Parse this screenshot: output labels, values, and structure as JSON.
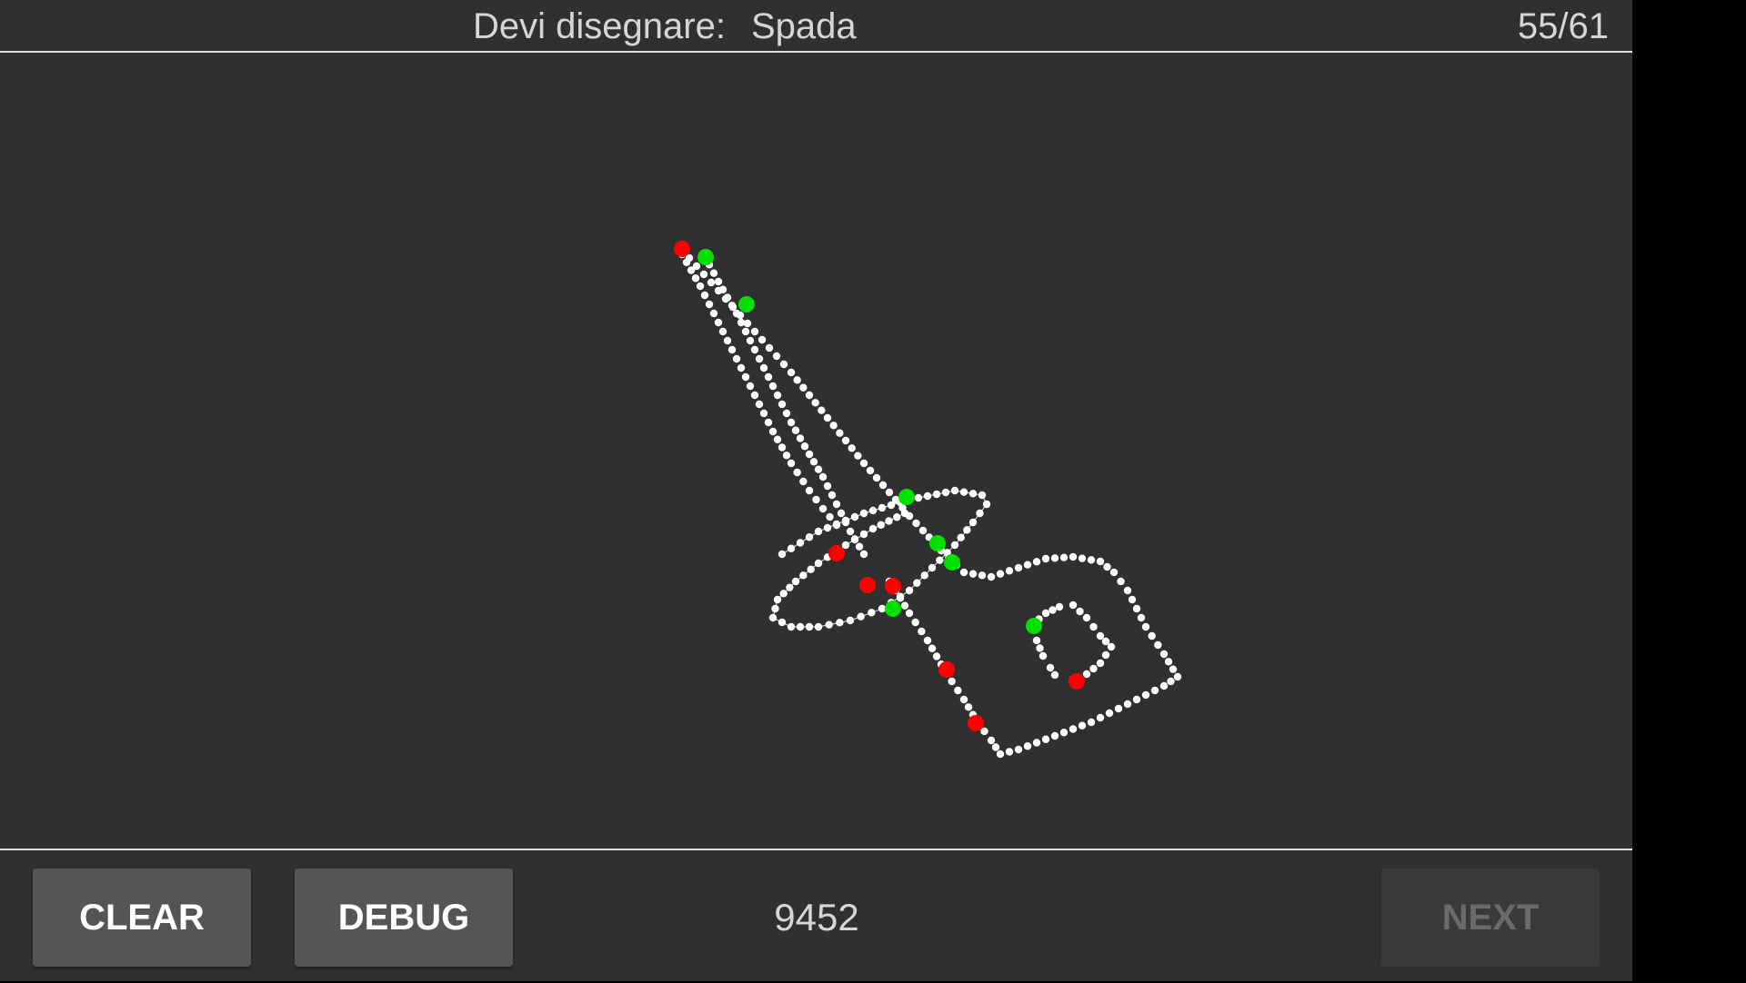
{
  "header": {
    "prompt_label": "Devi disegnare:",
    "target_word": "Spada",
    "progress": "55/61"
  },
  "footer": {
    "clear_label": "CLEAR",
    "debug_label": "DEBUG",
    "score": "9452",
    "next_label": "NEXT"
  },
  "colors": {
    "background": "#303030",
    "stroke_point": "#ffffff",
    "stroke_start": "#00e000",
    "stroke_end": "#ff0000",
    "connector_line": "#d0d0d0"
  }
}
